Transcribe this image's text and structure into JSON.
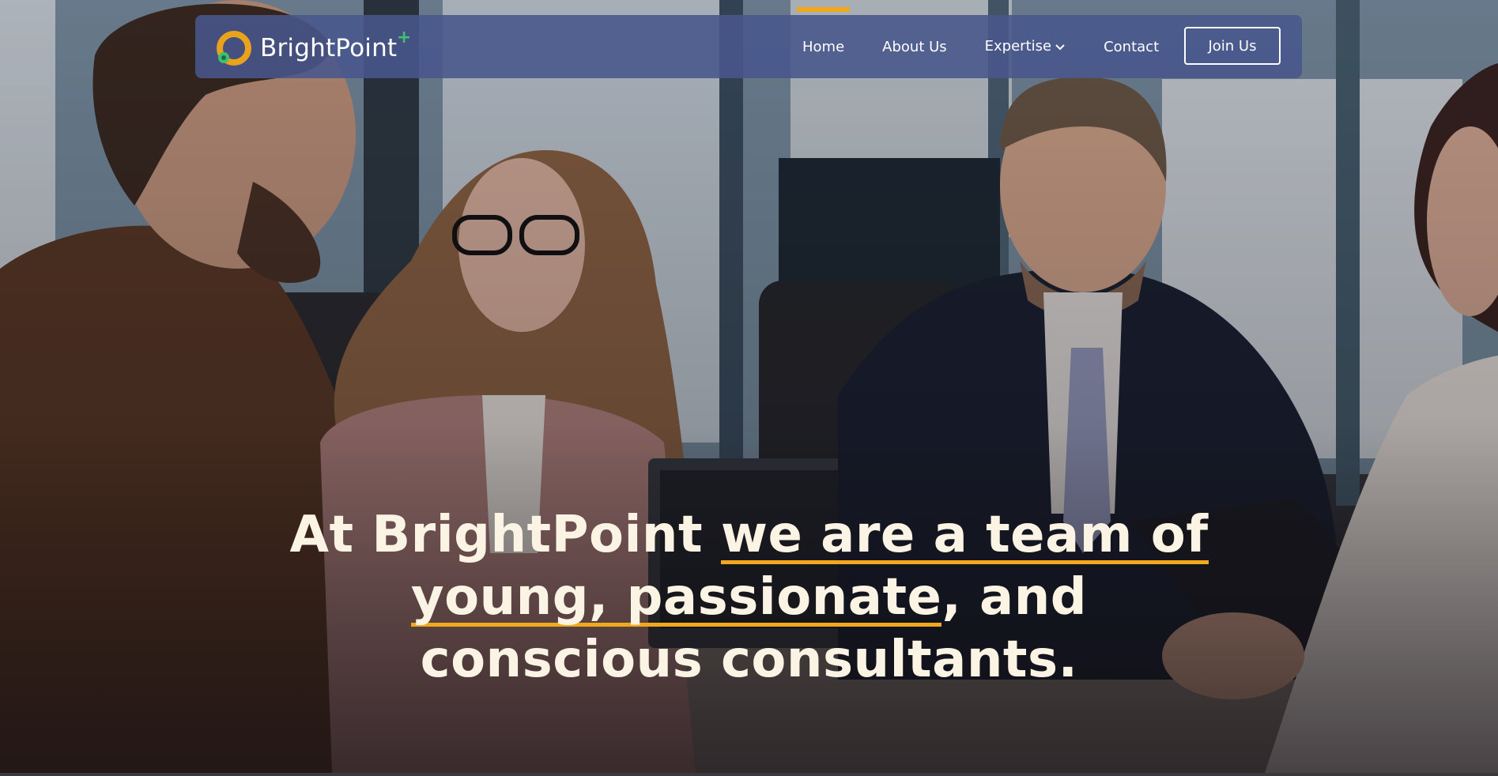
{
  "brand": {
    "name": "BrightPoint",
    "plus_symbol": "+",
    "logo_icon": "brightpoint-logo-icon",
    "accent_color": "#f2a81d",
    "logo_ring_color": "#e8a21c",
    "logo_dot_color": "#3fbf72",
    "navbar_color": "#48568c"
  },
  "nav": {
    "items": [
      {
        "label": "Home",
        "active": true
      },
      {
        "label": "About Us",
        "active": false
      },
      {
        "label": "Expertise",
        "active": false,
        "has_dropdown": true
      },
      {
        "label": "Contact",
        "active": false
      }
    ],
    "dropdown_icon": "chevron-down-icon",
    "cta_label": "Join Us"
  },
  "hero": {
    "background": "team-meeting-photo",
    "headline": {
      "part1": "At BrightPoint ",
      "highlight1": "we are a team of",
      "highlight2": "young, passionate",
      "part2": ", and conscious consultants."
    },
    "text_color": "#fbf3e4"
  }
}
